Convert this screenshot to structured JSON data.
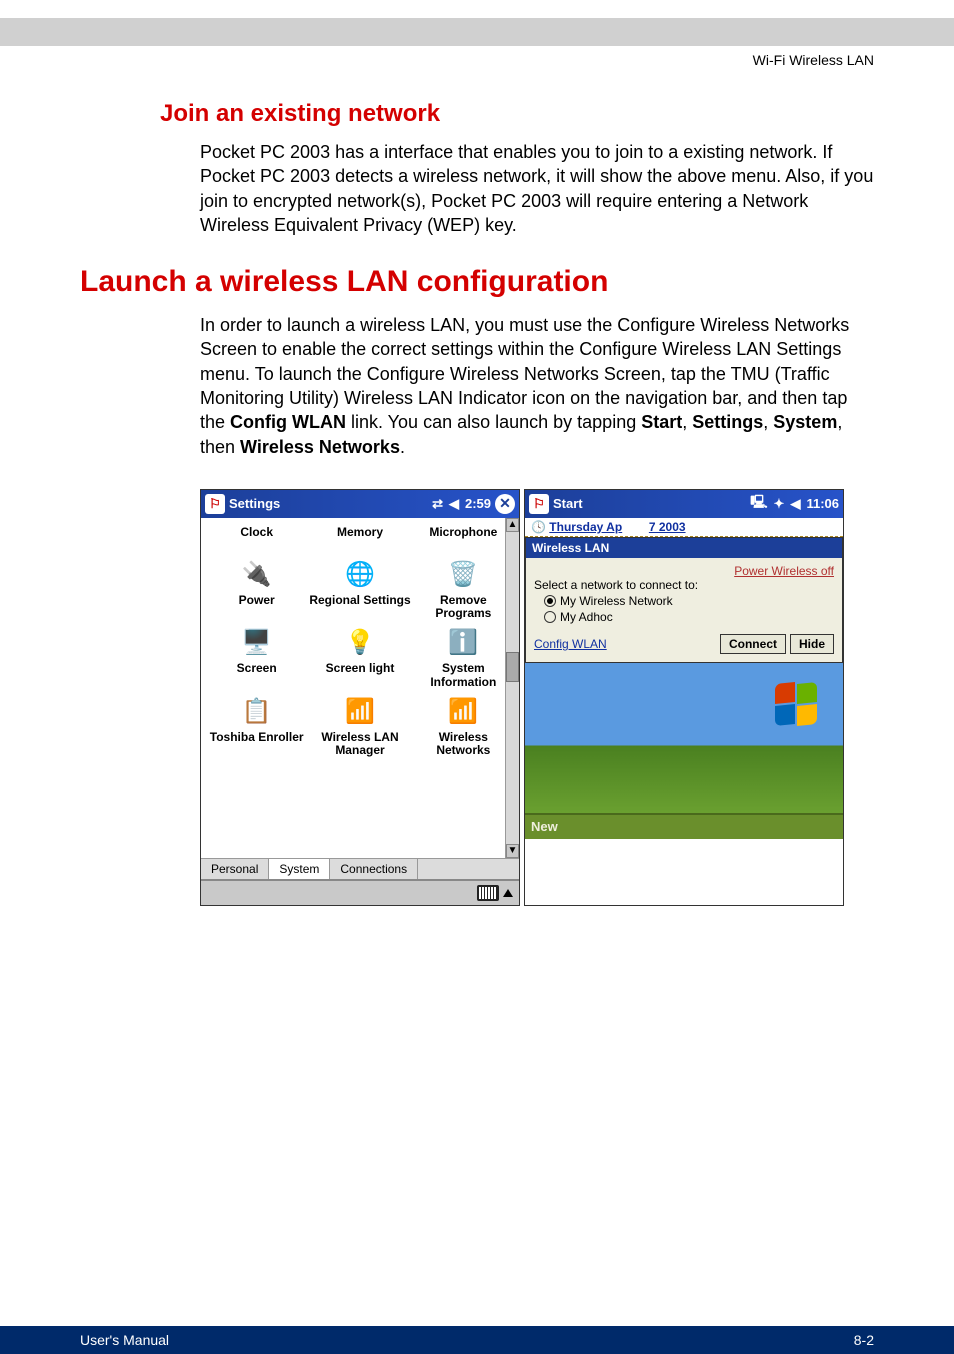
{
  "header": {
    "section": "Wi-Fi Wireless LAN"
  },
  "h2": "Join an existing network",
  "p1": "Pocket PC 2003 has a interface that enables you to join to a existing network. If Pocket PC 2003 detects a wireless network, it will show the above menu. Also, if you join to encrypted network(s), Pocket PC 2003 will require entering a Network Wireless Equivalent Privacy (WEP) key.",
  "h1": "Launch a wireless LAN configuration",
  "p2a": "In order to launch a wireless LAN, you must use the Configure Wireless Networks Screen to enable the correct settings within the Configure Wireless LAN Settings menu. To launch the Configure Wireless Networks Screen, tap the TMU (Traffic Monitoring Utility) Wireless LAN Indicator icon on the navigation bar, and then tap the ",
  "p2b": "Config WLAN",
  "p2c": " link. You can also launch by tapping ",
  "p2d": "Start",
  "p2e": ", ",
  "p2f": "Settings",
  "p2g": ", ",
  "p2h": "System",
  "p2i": ", then ",
  "p2j": "Wireless Networks",
  "p2k": ".",
  "left": {
    "title": "Settings",
    "time": "2:59",
    "close": "✕",
    "flag": "⚐",
    "status_arrows": "⇄",
    "status_vol": "◀",
    "icons": {
      "r0c0": "Clock",
      "r0c1": "Memory",
      "r0c2": "Microphone",
      "r1c0": "Power",
      "r1c1": "Regional Settings",
      "r1c2": "Remove Programs",
      "r2c0": "Screen",
      "r2c1": "Screen light",
      "r2c2": "System Information",
      "r3c0": "Toshiba Enroller",
      "r3c1": "Wireless LAN Manager",
      "r3c2": "Wireless Networks"
    },
    "tabs": {
      "t0": "Personal",
      "t1": "System",
      "t2": "Connections"
    }
  },
  "right": {
    "title": "Start",
    "time": "11:06",
    "flag": "⚐",
    "status_dev": "🖳",
    "status_conn": "✦",
    "status_vol": "◀",
    "today_a": "Thursday Ap",
    "today_b": "7 2003",
    "popup": {
      "title": "Wireless LAN",
      "power": "Power Wireless off",
      "select": "Select a network to connect to:",
      "opt0": "My Wireless Network",
      "opt1": "My Adhoc",
      "config": "Config WLAN",
      "btn0": "Connect",
      "btn1": "Hide"
    },
    "bottom": "New"
  },
  "footer": {
    "left": "User's Manual",
    "right": "8-2"
  }
}
